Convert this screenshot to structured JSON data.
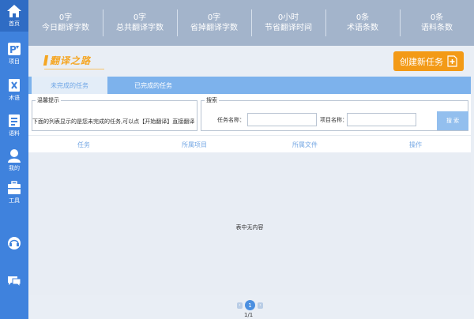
{
  "sidebar": {
    "items": [
      {
        "label": "首页",
        "icon": "home-icon"
      },
      {
        "label": "项目",
        "icon": "project-icon"
      },
      {
        "label": "术语",
        "icon": "term-icon"
      },
      {
        "label": "语料",
        "icon": "corpus-icon"
      },
      {
        "label": "我的",
        "icon": "user-icon"
      },
      {
        "label": "工具",
        "icon": "toolbox-icon"
      },
      {
        "label": "",
        "icon": "headset-icon"
      },
      {
        "label": "",
        "icon": "chat-icon"
      }
    ]
  },
  "stats": [
    {
      "value": "0字",
      "label": "今日翻译字数"
    },
    {
      "value": "0字",
      "label": "总共翻译字数"
    },
    {
      "value": "0字",
      "label": "省掉翻译字数"
    },
    {
      "value": "0小时",
      "label": "节省翻译时间"
    },
    {
      "value": "0条",
      "label": "术语条数"
    },
    {
      "value": "0条",
      "label": "语料条数"
    }
  ],
  "logo": {
    "text": "翻译之路"
  },
  "create_button": {
    "label": "创建新任务"
  },
  "tabs": [
    {
      "label": "未完成的任务"
    },
    {
      "label": "已完成的任务"
    }
  ],
  "tips": {
    "legend": "温馨提示",
    "text": "下面的列表显示的是您未完成的任务,可以点【开始翻译】直接翻译"
  },
  "search": {
    "legend": "搜索",
    "task_label": "任务名称：",
    "task_value": "",
    "project_label": "项目名称：",
    "project_value": "",
    "button": "搜 索"
  },
  "table": {
    "columns": [
      "任务",
      "所属项目",
      "所属文件",
      "操作"
    ],
    "rows": [],
    "empty_text": "表中无内容"
  },
  "pagination": {
    "current": "1",
    "prev": "‹",
    "next": "›",
    "info": "1/1"
  },
  "colors": {
    "sidebar": "#3f82dd",
    "stats_bar": "#a3b4cb",
    "accent": "#f39a16",
    "tabs": "#7db2ec"
  }
}
